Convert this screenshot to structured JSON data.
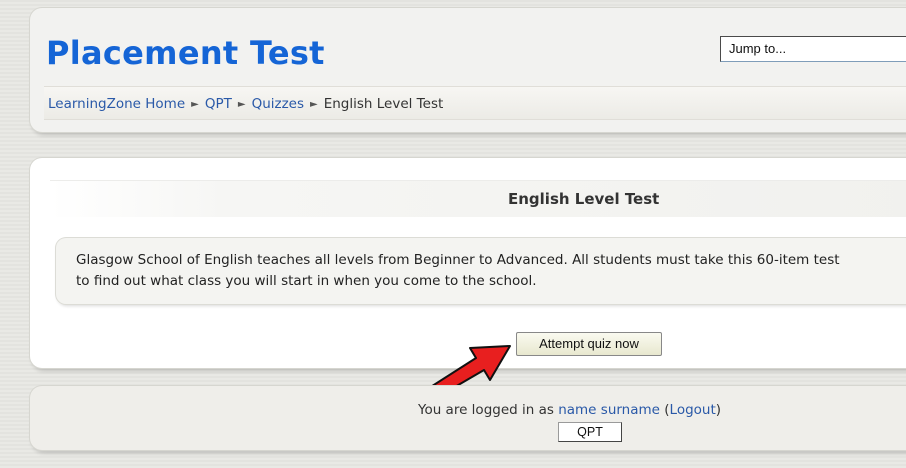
{
  "header": {
    "title": "Placement Test",
    "jump_to": "Jump to...",
    "breadcrumb": {
      "home": "LearningZone Home",
      "course": "QPT",
      "section": "Quizzes",
      "current": "English Level Test"
    }
  },
  "main": {
    "heading": "English Level Test",
    "intro": "Glasgow School of English teaches all levels from Beginner to Advanced. All students must take this 60-item test to find out what class you will start in when you come to the school.",
    "attempt_button": "Attempt quiz now"
  },
  "footer": {
    "logged_in_prefix": "You are logged in as",
    "user_name": "name surname",
    "logout_open": "(",
    "logout_label": "Logout",
    "logout_close": ")",
    "course_button": "QPT"
  },
  "colors": {
    "title": "#1565d6",
    "link": "#2a59a8",
    "arrow": "#e81f1f"
  }
}
